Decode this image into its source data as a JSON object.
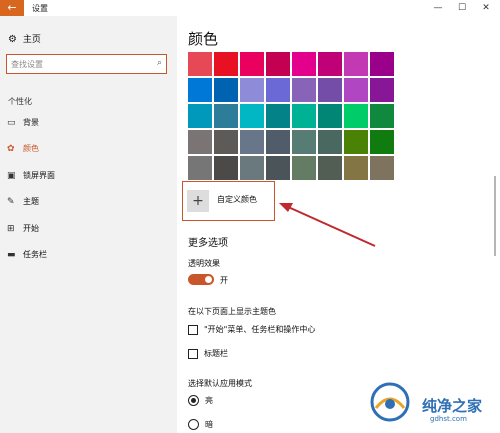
{
  "window": {
    "back_glyph": "←",
    "title": "设置",
    "controls": [
      "—",
      "☐",
      "✕"
    ]
  },
  "sidebar": {
    "home_label": "主页",
    "search_placeholder": "查找设置",
    "section_label": "个性化",
    "items": [
      {
        "label": "背景",
        "icon": "picture-icon"
      },
      {
        "label": "颜色",
        "icon": "palette-icon",
        "active": true
      },
      {
        "label": "锁屏界面",
        "icon": "lock-screen-icon"
      },
      {
        "label": "主题",
        "icon": "theme-icon"
      },
      {
        "label": "开始",
        "icon": "start-icon"
      },
      {
        "label": "任务栏",
        "icon": "taskbar-icon"
      }
    ]
  },
  "main": {
    "title": "颜色",
    "swatches": [
      "#e74856",
      "#e81123",
      "#ea005e",
      "#c30052",
      "#e3008c",
      "#bf0077",
      "#c239b3",
      "#9a0089",
      "#0078d7",
      "#0063b1",
      "#8e8cd8",
      "#6b69d6",
      "#8764b8",
      "#744da9",
      "#b146c2",
      "#881798",
      "#0099bc",
      "#2d7d9a",
      "#00b7c3",
      "#038387",
      "#00b294",
      "#018574",
      "#00cc6a",
      "#10893e",
      "#7a7574",
      "#5d5a58",
      "#68768a",
      "#515c6b",
      "#567c73",
      "#486860",
      "#498205",
      "#107c10",
      "#767676",
      "#4c4a48",
      "#69797e",
      "#4a5459",
      "#647c64",
      "#525e54",
      "#847545",
      "#7e735f"
    ],
    "custom_color_label": "自定义颜色",
    "more_options_title": "更多选项",
    "transparency_label": "透明效果",
    "transparency_state": "开",
    "accent_surface_heading": "在以下页面上显示主题色",
    "accent_checkboxes": [
      "\"开始\"菜单、任务栏和操作中心",
      "标题栏"
    ],
    "app_mode_heading": "选择默认应用模式",
    "app_modes": [
      "亮",
      "暗"
    ]
  },
  "watermark": {
    "name": "纯净之家",
    "url": "gdhst.com"
  },
  "colors": {
    "accent": "#c9562a",
    "sidebar_bg": "#f2f2f2",
    "annotation": "#c0282e"
  }
}
